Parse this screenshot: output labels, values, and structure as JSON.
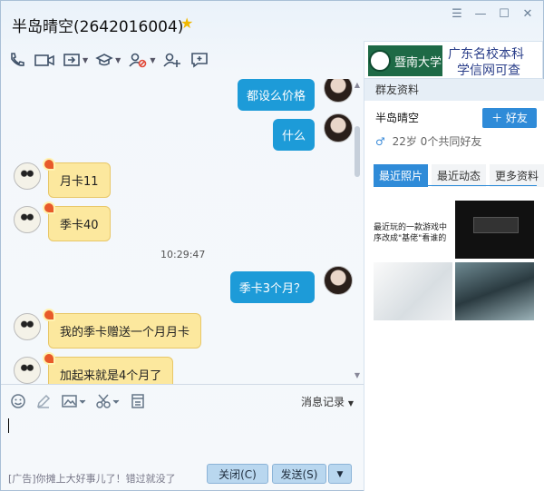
{
  "window": {
    "title": "半岛晴空(2642016004)",
    "controls": [
      "menu-icon",
      "minimize-icon",
      "maximize-icon",
      "close-icon"
    ]
  },
  "toolbar": {
    "icons": [
      "phone-icon",
      "video-icon",
      "share-screen-icon",
      "app-icon",
      "block-user-icon",
      "add-friend-icon",
      "comment-icon"
    ]
  },
  "ad_banner": {
    "school": "暨南大学",
    "line1": "广东名校本科",
    "line2": "学信网可查"
  },
  "messages": [
    {
      "side": "right",
      "text": "都设么价格"
    },
    {
      "side": "right",
      "text": "什么"
    },
    {
      "side": "left",
      "text": "月卡11"
    },
    {
      "side": "left",
      "text": "季卡40"
    },
    {
      "side": "time",
      "text": "10:29:47"
    },
    {
      "side": "right",
      "text": "季卡3个月？"
    },
    {
      "side": "left",
      "text": "我的季卡赠送一个月月卡"
    },
    {
      "side": "left",
      "text": "加起来就是4个月了"
    }
  ],
  "input_toolbar": {
    "icons": [
      "emoji-icon",
      "edit-icon",
      "image-icon",
      "scissors-icon",
      "history-icon"
    ],
    "history_label": "消息记录"
  },
  "footer": {
    "ad_text": "[广告]你摊上大好事儿了！错过就没了",
    "close_label": "关闭(C)",
    "send_label": "发送(S)"
  },
  "side_panel": {
    "header": "群友资料",
    "name": "半岛晴空",
    "add_friend_label": "好友",
    "meta": "22岁  0个共同好友",
    "tabs": [
      "最近照片",
      "最近动态",
      "更多资料"
    ],
    "active_tab": 0,
    "photo1_lines": [
      "最近玩的一款游戏中",
      "序改成\"基佬\"看谁的"
    ]
  },
  "colors": {
    "accent": "#1d9bd8",
    "received_bubble": "#fce89e"
  }
}
